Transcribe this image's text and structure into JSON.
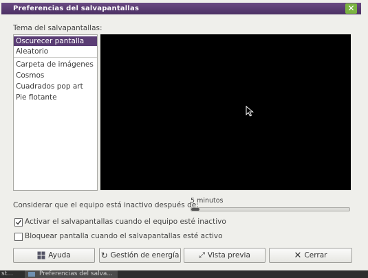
{
  "window": {
    "title": "Preferencias del salvapantallas"
  },
  "theme_label": "Tema del salvapantallas:",
  "themes": {
    "selected": "Oscurecer pantalla",
    "items": [
      "Oscurecer pantalla",
      "Aleatorio",
      "Carpeta de imágenes",
      "Cosmos",
      "Cuadrados pop art",
      "Pie flotante"
    ]
  },
  "idle": {
    "label": "Considerar que el equipo está inactivo después de:",
    "value": "5 minutos",
    "fraction": 0.05
  },
  "checkboxes": [
    {
      "label": "Activar el salvapantallas cuando el equipo esté inactivo",
      "checked": true
    },
    {
      "label": "Bloquear pantalla cuando el salvapantallas esté activo",
      "checked": false
    }
  ],
  "buttons": {
    "help": "Ayuda",
    "power": "Gestión de energía",
    "preview": "Vista previa",
    "close": "Cerrar"
  },
  "taskbar": {
    "left_fragment": "st...",
    "task": "Preferencias del salva..."
  },
  "colors": {
    "title_bar": "#5a3d74",
    "selection": "#5a3d74",
    "close_button": "#7bb441"
  },
  "icons": [
    "close-icon",
    "help-icon",
    "power-icon",
    "fullscreen-icon",
    "close-x-icon",
    "window-icon",
    "mouse-pointer-icon"
  ]
}
